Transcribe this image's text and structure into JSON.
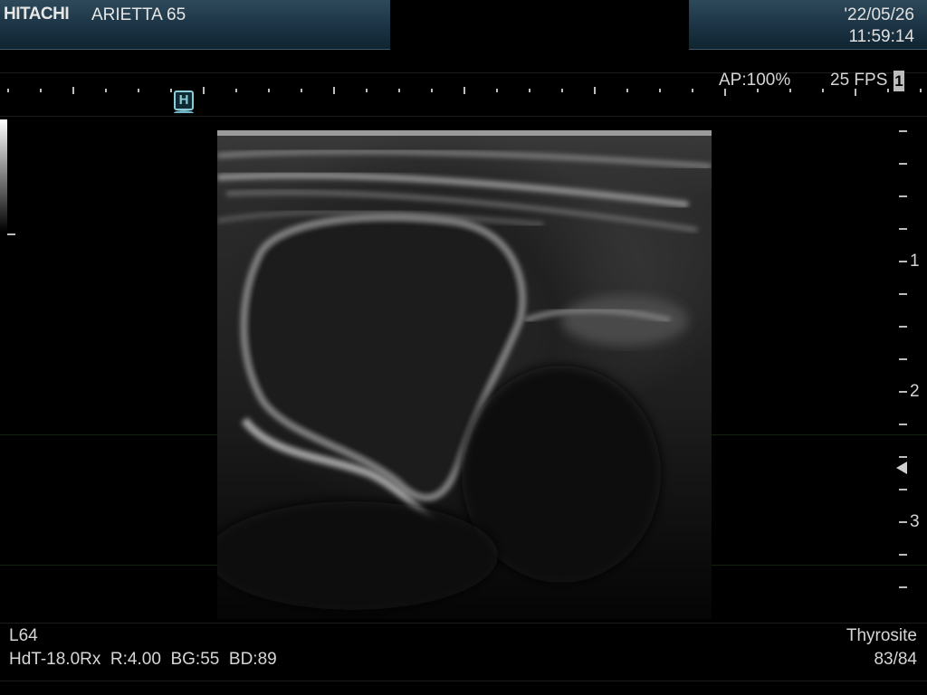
{
  "header": {
    "brand": "HITACHI",
    "model": "ARIETTA 65",
    "date": "'22/05/26",
    "time": "11:59:14"
  },
  "status": {
    "acoustic_power": "AP:100%",
    "frame_rate": "25 FPS",
    "frame_index": "1"
  },
  "marker": {
    "label": "H"
  },
  "depth_scale": {
    "labels": [
      "1",
      "2",
      "3"
    ]
  },
  "bottom_left": {
    "probe": "L64",
    "settings": "HdT-18.0Rx  R:4.00  BG:55  BD:89"
  },
  "bottom_right": {
    "preset": "Thyrosite",
    "frame_count": "83/84"
  },
  "colors": {
    "header_band": "#1b3344",
    "marker": "#8ccbd8",
    "text": "#d6d6d6",
    "background": "#000000"
  }
}
